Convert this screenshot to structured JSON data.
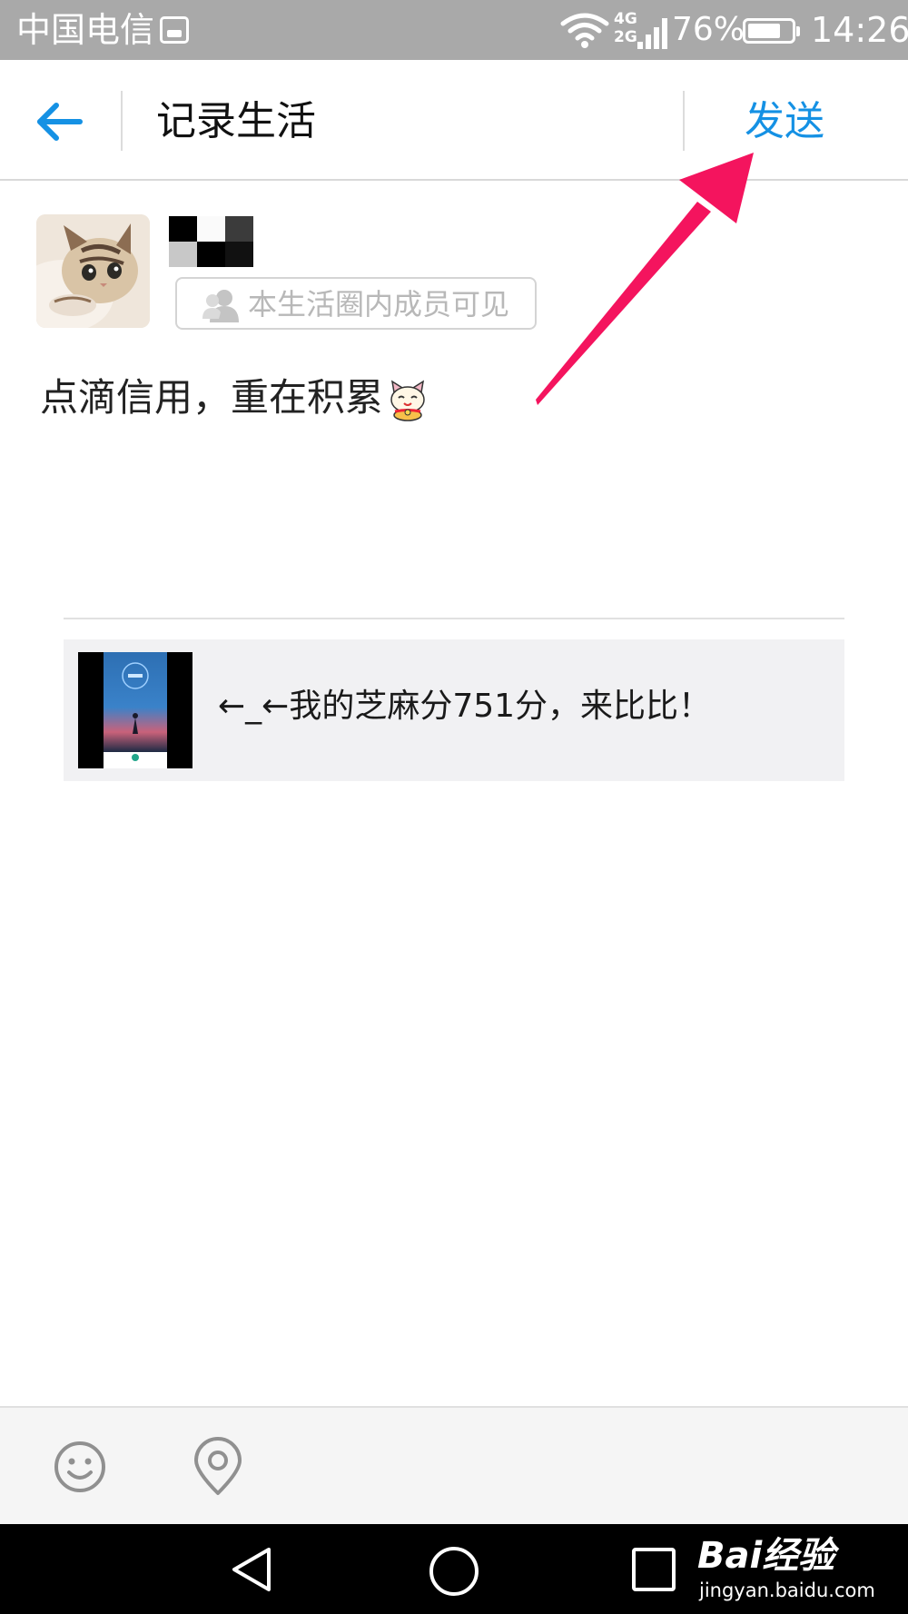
{
  "status_bar": {
    "carrier": "中国电信",
    "network_types": [
      "4G",
      "2G"
    ],
    "battery_percent": "76%",
    "battery_level": 0.76,
    "time": "14:26"
  },
  "header": {
    "title": "记录生活",
    "send_label": "发送",
    "back_icon": "arrow-left-icon"
  },
  "post": {
    "visibility": "本生活圈内成员可见",
    "text": "点滴信用，重在积累",
    "emoji": "lucky-cat-emoji"
  },
  "share_card": {
    "text": "←_←我的芝麻分751分，来比比！"
  },
  "toolbar": {
    "icons": [
      "smiley-icon",
      "location-pin-icon"
    ]
  },
  "nav_bar": {
    "icons": [
      "triangle-back-icon",
      "circle-home-icon",
      "square-recent-icon"
    ]
  },
  "watermark": {
    "brand": "Bai经验",
    "url": "jingyan.baidu.com"
  },
  "colors": {
    "accent": "#1591e4",
    "annotation_arrow": "#f4145e",
    "status_bar": "#a9a9a9"
  }
}
